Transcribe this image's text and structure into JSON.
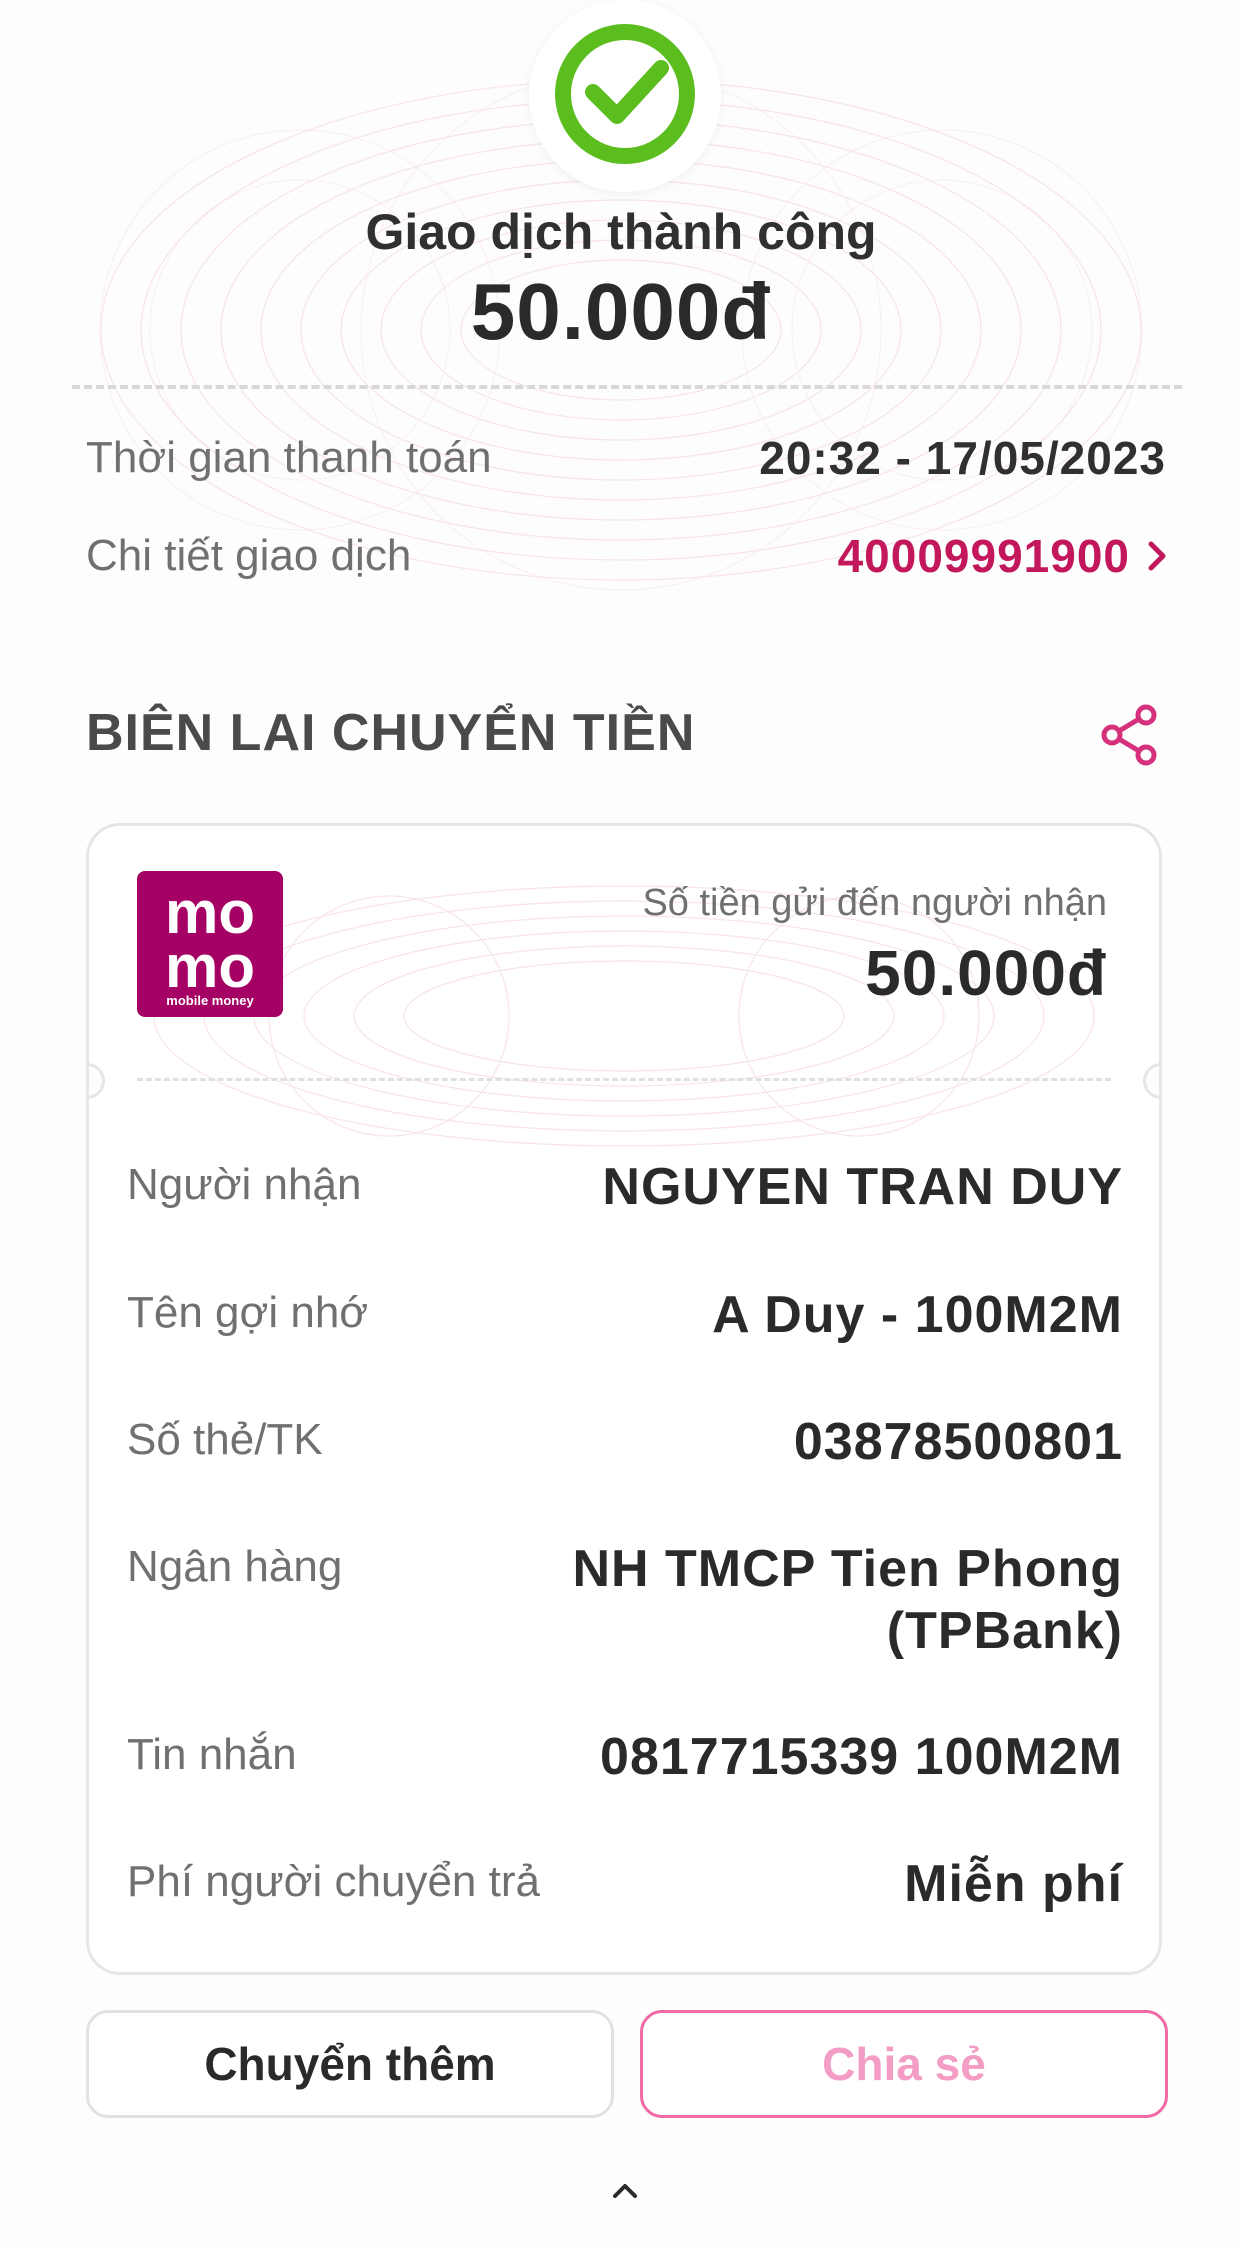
{
  "header": {
    "status_title": "Giao dịch thành công",
    "amount": "50.000đ"
  },
  "info": {
    "time_label": "Thời gian thanh toán",
    "time_value": "20:32 - 17/05/2023",
    "detail_label": "Chi tiết giao dịch",
    "detail_value": "40009991900"
  },
  "receipt": {
    "section_title": "BIÊN LAI CHUYỂN TIỀN",
    "amount_label": "Số tiền gửi đến người nhận",
    "amount": "50.000đ",
    "logo_text_top": "mo",
    "logo_text_bottom": "mo",
    "logo_caption": "mobile money",
    "rows": [
      {
        "label": "Người nhận",
        "value": "NGUYEN TRAN DUY"
      },
      {
        "label": "Tên gợi nhớ",
        "value": "A Duy - 100M2M"
      },
      {
        "label": "Số thẻ/TK",
        "value": "03878500801"
      },
      {
        "label": "Ngân hàng",
        "value": "NH TMCP Tien Phong",
        "value2": "(TPBank)"
      },
      {
        "label": "Tin nhắn",
        "value": "0817715339 100M2M"
      },
      {
        "label": "Phí người chuyển trả",
        "value": "Miễn phí"
      }
    ]
  },
  "buttons": {
    "transfer_more": "Chuyển thêm",
    "share": "Chia sẻ"
  },
  "icons": {
    "success": "check-circle-icon",
    "link_chevron": "chevron-right-icon",
    "share": "share-icon",
    "bottom": "chevron-up-icon"
  },
  "colors": {
    "success_green": "#5bbd1e",
    "accent_pink": "#c2185b",
    "momo_brand": "#a50064",
    "share_button_border": "#f06aa7"
  }
}
